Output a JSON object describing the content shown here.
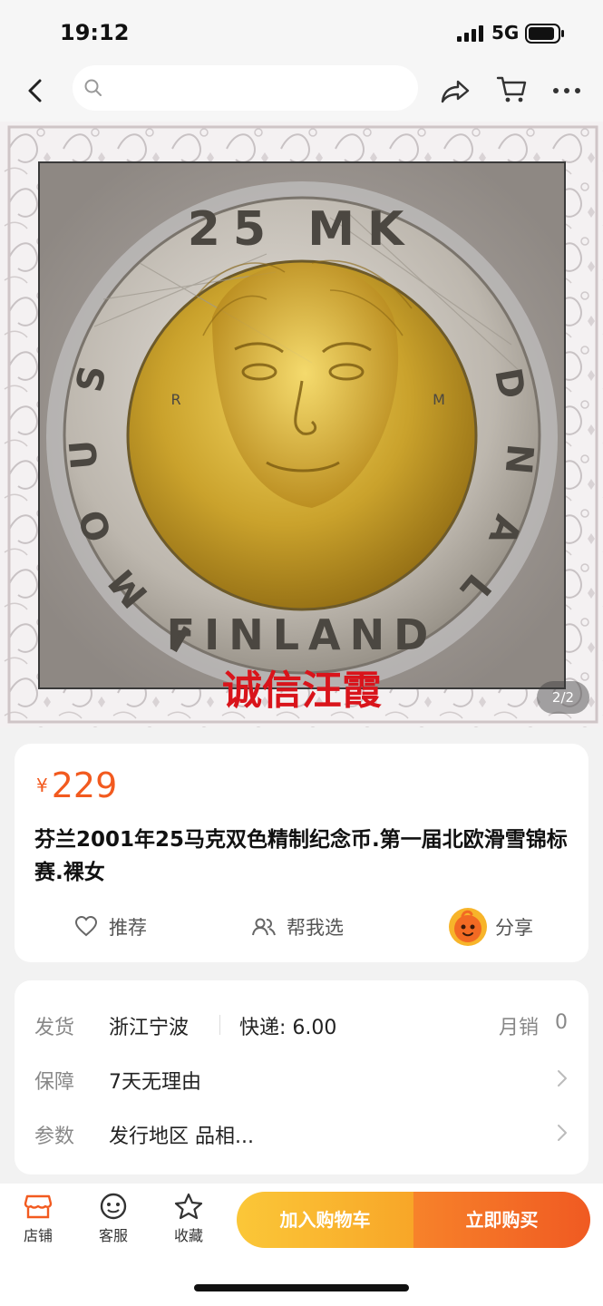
{
  "status_bar": {
    "time": "19:12",
    "network": "5G"
  },
  "nav": {
    "search_placeholder": ""
  },
  "gallery": {
    "pager": "2/2",
    "watermark": "诚信汪霞",
    "coin_rim_text": "25 MK",
    "coin_legend": "SUOMI FINLAND",
    "mint_marks": [
      "R",
      "M"
    ]
  },
  "product": {
    "currency": "¥",
    "price": "229",
    "title": "芬兰2001年25马克双色精制纪念币.第一届北欧滑雪锦标赛.裸女",
    "actions": {
      "recommend": "推荐",
      "help_choose": "帮我选",
      "share": "分享"
    }
  },
  "info": {
    "shipping": {
      "label": "发货",
      "origin": "浙江宁波",
      "express": "快递: 6.00",
      "monthly_label": "月销",
      "monthly_value": "0"
    },
    "guarantee": {
      "label": "保障",
      "value": "7天无理由"
    },
    "params": {
      "label": "参数",
      "value": "发行地区 品相..."
    }
  },
  "bottom_bar": {
    "store": "店铺",
    "service": "客服",
    "favorite": "收藏",
    "add_to_cart": "加入购物车",
    "buy_now": "立即购买"
  },
  "colors": {
    "accent": "#f25a1f",
    "cart_yellow": "#fbc738",
    "buy_orange": "#f05a22"
  }
}
